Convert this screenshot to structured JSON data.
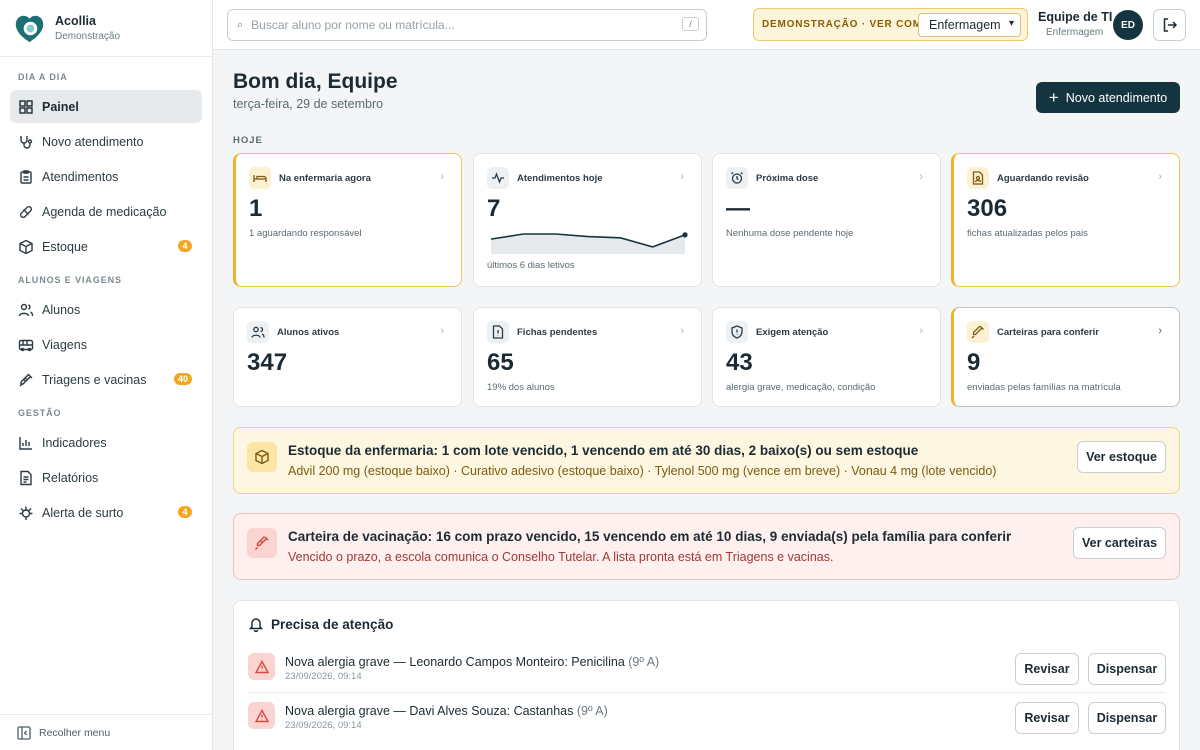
{
  "brand": {
    "name": "Acollia",
    "subtitle": "Demonstração"
  },
  "sidebar": {
    "sections": [
      {
        "title": "DIA A DIA"
      },
      {
        "title": "ALUNOS E VIAGENS"
      },
      {
        "title": "GESTÃO"
      }
    ],
    "items": [
      {
        "label": "Painel",
        "icon": "grid-icon",
        "active": true
      },
      {
        "label": "Novo atendimento",
        "icon": "stethoscope-icon"
      },
      {
        "label": "Atendimentos",
        "icon": "clipboard-icon"
      },
      {
        "label": "Agenda de medicação",
        "icon": "pill-icon"
      },
      {
        "label": "Estoque",
        "icon": "package-icon",
        "badge": "4"
      },
      {
        "label": "Alunos",
        "icon": "users-icon"
      },
      {
        "label": "Viagens",
        "icon": "bus-icon"
      },
      {
        "label": "Triagens e vacinas",
        "icon": "syringe-icon",
        "badge": "40"
      },
      {
        "label": "Indicadores",
        "icon": "bar-chart-icon"
      },
      {
        "label": "Relatórios",
        "icon": "file-icon"
      },
      {
        "label": "Alerta de surto",
        "icon": "virus-icon",
        "badge": "4"
      }
    ],
    "collapse_label": "Recolher menu"
  },
  "header": {
    "search_placeholder": "Buscar aluno por nome ou matrícula...",
    "search_shortcut": "/",
    "demo_label": "DEMONSTRAÇÃO · VER COMO",
    "demo_selected": "Enfermagem",
    "user_name": "Equipe de TI",
    "user_role": "Enfermagem",
    "avatar_initials": "ED"
  },
  "main": {
    "greeting": "Bom dia, Equipe",
    "date": "terça-feira, 29 de setembro",
    "new_button": "Novo atendimento",
    "today_label": "HOJE",
    "cards": [
      {
        "title": "Na enfermaria agora",
        "value": "1",
        "subtitle": "1 aguardando responsável",
        "icon": "bed-icon"
      },
      {
        "title": "Atendimentos hoje",
        "value": "7",
        "subtitle": "últimos 6 dias letivos",
        "icon": "activity-icon"
      },
      {
        "title": "Próxima dose",
        "value": "—",
        "subtitle": "Nenhuma dose pendente hoje",
        "icon": "alarm-clock-icon"
      },
      {
        "title": "Aguardando revisão",
        "value": "306",
        "subtitle": "fichas atualizadas pelos pais",
        "icon": "file-user-icon"
      },
      {
        "title": "Alunos ativos",
        "value": "347",
        "subtitle": "",
        "icon": "users-icon"
      },
      {
        "title": "Fichas pendentes",
        "value": "65",
        "subtitle": "19% dos alunos",
        "icon": "file-alert-icon"
      },
      {
        "title": "Exigem atenção",
        "value": "43",
        "subtitle": "alergia grave, medicação, condição",
        "icon": "shield-alert-icon"
      },
      {
        "title": "Carteiras para conferir",
        "value": "9",
        "subtitle": "enviadas pelas famílias na matrícula",
        "icon": "syringe-icon"
      }
    ],
    "sparkline": [
      3,
      4.2,
      4.2,
      3.6,
      3.3,
      1.2,
      4
    ]
  },
  "alerts": {
    "stock": {
      "title": "Estoque da enfermaria: 1 com lote vencido, 1 vencendo em até 30 dias, 2 baixo(s) ou sem estoque",
      "text": "Advil 200 mg (estoque baixo) · Curativo adesivo (estoque baixo) · Tylenol 500 mg (vence em breve) · Vonau 4 mg (lote vencido)",
      "button": "Ver estoque"
    },
    "vaccination": {
      "title": "Carteira de vacinação: 16 com prazo vencido, 15 vencendo em até 10 dias, 9 enviada(s) pela família para conferir",
      "text": "Vencido o prazo, a escola comunica o Conselho Tutelar. A lista pronta está em Triagens e vacinas.",
      "button": "Ver carteiras"
    }
  },
  "attention": {
    "title": "Precisa de atenção",
    "rows": [
      {
        "text": "Nova alergia grave — Leonardo Campos Monteiro: Penicilina",
        "class": "(9º A)",
        "time": "23/09/2026, 09:14",
        "review": "Revisar",
        "dismiss": "Dispensar"
      },
      {
        "text": "Nova alergia grave — Davi Alves Souza: Castanhas",
        "class": "(9º A)",
        "time": "23/09/2026, 09:14",
        "review": "Revisar",
        "dismiss": "Dispensar"
      }
    ]
  },
  "colors": {
    "primary": "#14343f",
    "accent": "#f0b429",
    "danger": "#d84a41"
  }
}
